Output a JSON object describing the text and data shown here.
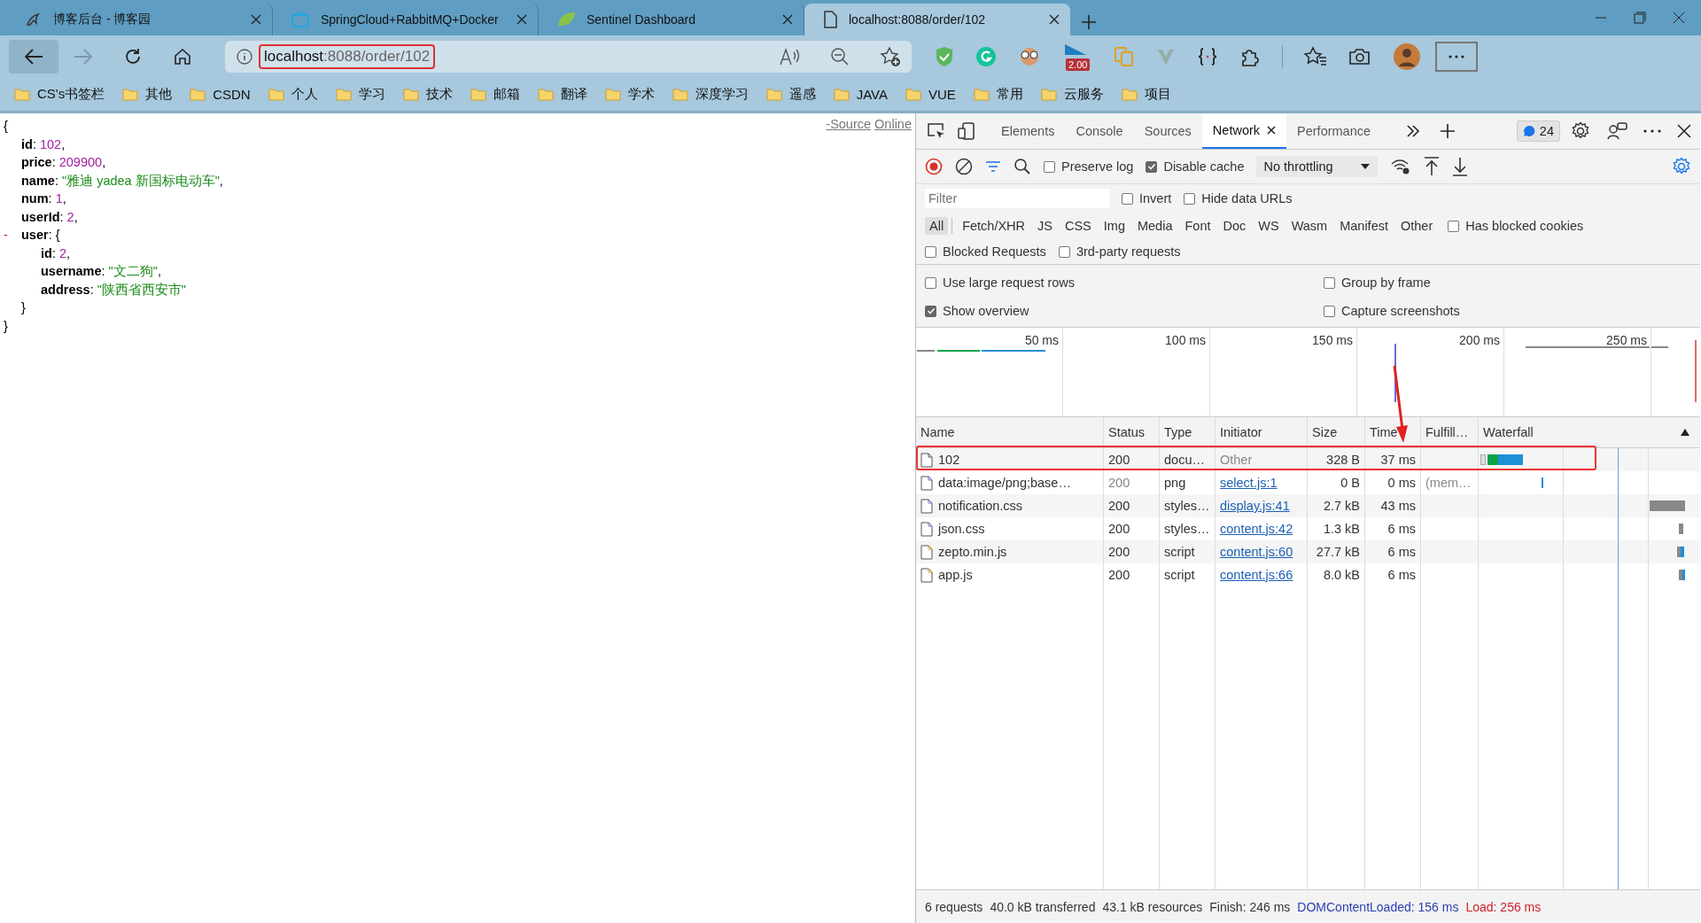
{
  "browser": {
    "tabs": [
      {
        "title": "博客后台 - 博客园",
        "selected": false
      },
      {
        "title": "SpringCloud+RabbitMQ+Docker",
        "selected": false
      },
      {
        "title": "Sentinel Dashboard",
        "selected": false
      },
      {
        "title": "localhost:8088/order/102",
        "selected": true
      }
    ],
    "address": {
      "host": "localhost",
      "path": ":8088/order/102"
    },
    "extension_badge": "2.00",
    "bookmarks": [
      "CS's书签栏",
      "其他",
      "CSDN",
      "个人",
      "学习",
      "技术",
      "邮箱",
      "翻译",
      "学术",
      "深度学习",
      "遥感",
      "JAVA",
      "VUE",
      "常用",
      "云服务",
      "项目"
    ]
  },
  "page": {
    "source_links": [
      "-Source",
      "Online"
    ],
    "json": {
      "open": "{",
      "close": "}",
      "fields": [
        {
          "key": "id",
          "colon": ":",
          "value": "102",
          "kind": "number",
          "end": ","
        },
        {
          "key": "price",
          "colon": ":",
          "value": "209900",
          "kind": "number",
          "end": ","
        },
        {
          "key": "name",
          "colon": ":",
          "value": "\"雅迪 yadea 新国标电动车\"",
          "kind": "string",
          "end": ","
        },
        {
          "key": "num",
          "colon": ":",
          "value": "1",
          "kind": "number",
          "end": ","
        },
        {
          "key": "userId",
          "colon": ":",
          "value": "2",
          "kind": "number",
          "end": ","
        },
        {
          "key": "user",
          "colon": ":",
          "kind": "object",
          "toggle": "-",
          "expanded": true,
          "open": "{",
          "close": "}",
          "children": [
            {
              "key": "id",
              "colon": ":",
              "value": "2",
              "kind": "number",
              "end": ","
            },
            {
              "key": "username",
              "colon": ":",
              "value": "\"文二狗\"",
              "kind": "string",
              "end": ","
            },
            {
              "key": "address",
              "colon": ":",
              "value": "\"陕西省西安市\"",
              "kind": "string"
            }
          ]
        }
      ]
    }
  },
  "devtools": {
    "tabs": [
      {
        "label": "Elements",
        "selected": false,
        "closable": false
      },
      {
        "label": "Console",
        "selected": false,
        "closable": false
      },
      {
        "label": "Sources",
        "selected": false,
        "closable": false
      },
      {
        "label": "Network",
        "selected": true,
        "closable": true
      },
      {
        "label": "Performance",
        "selected": false,
        "closable": false
      }
    ],
    "issues_count": "24",
    "toolbar": {
      "preserve_log": {
        "label": "Preserve log",
        "checked": false
      },
      "disable_cache": {
        "label": "Disable cache",
        "checked": true
      },
      "throttling": "No throttling"
    },
    "filter": {
      "placeholder": "Filter",
      "invert": {
        "label": "Invert",
        "checked": false
      },
      "hide_data_urls": {
        "label": "Hide data URLs",
        "checked": false
      }
    },
    "type_filters": [
      {
        "label": "All",
        "selected": true
      },
      {
        "label": "Fetch/XHR",
        "selected": false
      },
      {
        "label": "JS",
        "selected": false
      },
      {
        "label": "CSS",
        "selected": false
      },
      {
        "label": "Img",
        "selected": false
      },
      {
        "label": "Media",
        "selected": false
      },
      {
        "label": "Font",
        "selected": false
      },
      {
        "label": "Doc",
        "selected": false
      },
      {
        "label": "WS",
        "selected": false
      },
      {
        "label": "Wasm",
        "selected": false
      },
      {
        "label": "Manifest",
        "selected": false
      },
      {
        "label": "Other",
        "selected": false
      }
    ],
    "has_blocked_cookies": {
      "label": "Has blocked cookies",
      "checked": false
    },
    "blocked_requests": {
      "label": "Blocked Requests",
      "checked": false
    },
    "third_party": {
      "label": "3rd-party requests",
      "checked": false
    },
    "options": [
      {
        "label": "Use large request rows",
        "checked": false
      },
      {
        "label": "Group by frame",
        "checked": false
      },
      {
        "label": "Show overview",
        "checked": true
      },
      {
        "label": "Capture screenshots",
        "checked": false
      }
    ],
    "overview_ticks": [
      "50 ms",
      "100 ms",
      "150 ms",
      "200 ms",
      "250 ms"
    ],
    "columns": [
      "Name",
      "Status",
      "Type",
      "Initiator",
      "Size",
      "Time",
      "Fulfill…",
      "Waterfall"
    ],
    "rows": [
      {
        "name": "102",
        "kind": "document",
        "status": "200",
        "status_muted": false,
        "type": "docu…",
        "initiator": "Other",
        "initiator_link": false,
        "size": "328 B",
        "time": "37 ms"
      },
      {
        "name": "data:image/png;base…",
        "kind": "image",
        "status": "200",
        "status_muted": true,
        "type": "png",
        "initiator": "select.js:1",
        "initiator_link": true,
        "size": "0 B",
        "time": "0 ms",
        "fulfilled": "(mem…"
      },
      {
        "name": "notification.css",
        "kind": "stylesheet",
        "status": "200",
        "status_muted": false,
        "type": "styles…",
        "initiator": "display.js:41",
        "initiator_link": true,
        "size": "2.7 kB",
        "time": "43 ms"
      },
      {
        "name": "json.css",
        "kind": "stylesheet",
        "status": "200",
        "status_muted": false,
        "type": "styles…",
        "initiator": "content.js:42",
        "initiator_link": true,
        "size": "1.3 kB",
        "time": "6 ms"
      },
      {
        "name": "zepto.min.js",
        "kind": "script",
        "status": "200",
        "status_muted": false,
        "type": "script",
        "initiator": "content.js:60",
        "initiator_link": true,
        "size": "27.7 kB",
        "time": "6 ms"
      },
      {
        "name": "app.js",
        "kind": "script",
        "status": "200",
        "status_muted": false,
        "type": "script",
        "initiator": "content.js:66",
        "initiator_link": true,
        "size": "8.0 kB",
        "time": "6 ms"
      }
    ],
    "summary": [
      {
        "text": "6 requests",
        "kind": "plain"
      },
      {
        "text": "40.0 kB transferred",
        "kind": "plain"
      },
      {
        "text": "43.1 kB resources",
        "kind": "plain"
      },
      {
        "text": "Finish: 246 ms",
        "kind": "plain"
      },
      {
        "text": "DOMContentLoaded: 156 ms",
        "kind": "dom"
      },
      {
        "text": "Load: 256 ms",
        "kind": "load"
      }
    ]
  }
}
